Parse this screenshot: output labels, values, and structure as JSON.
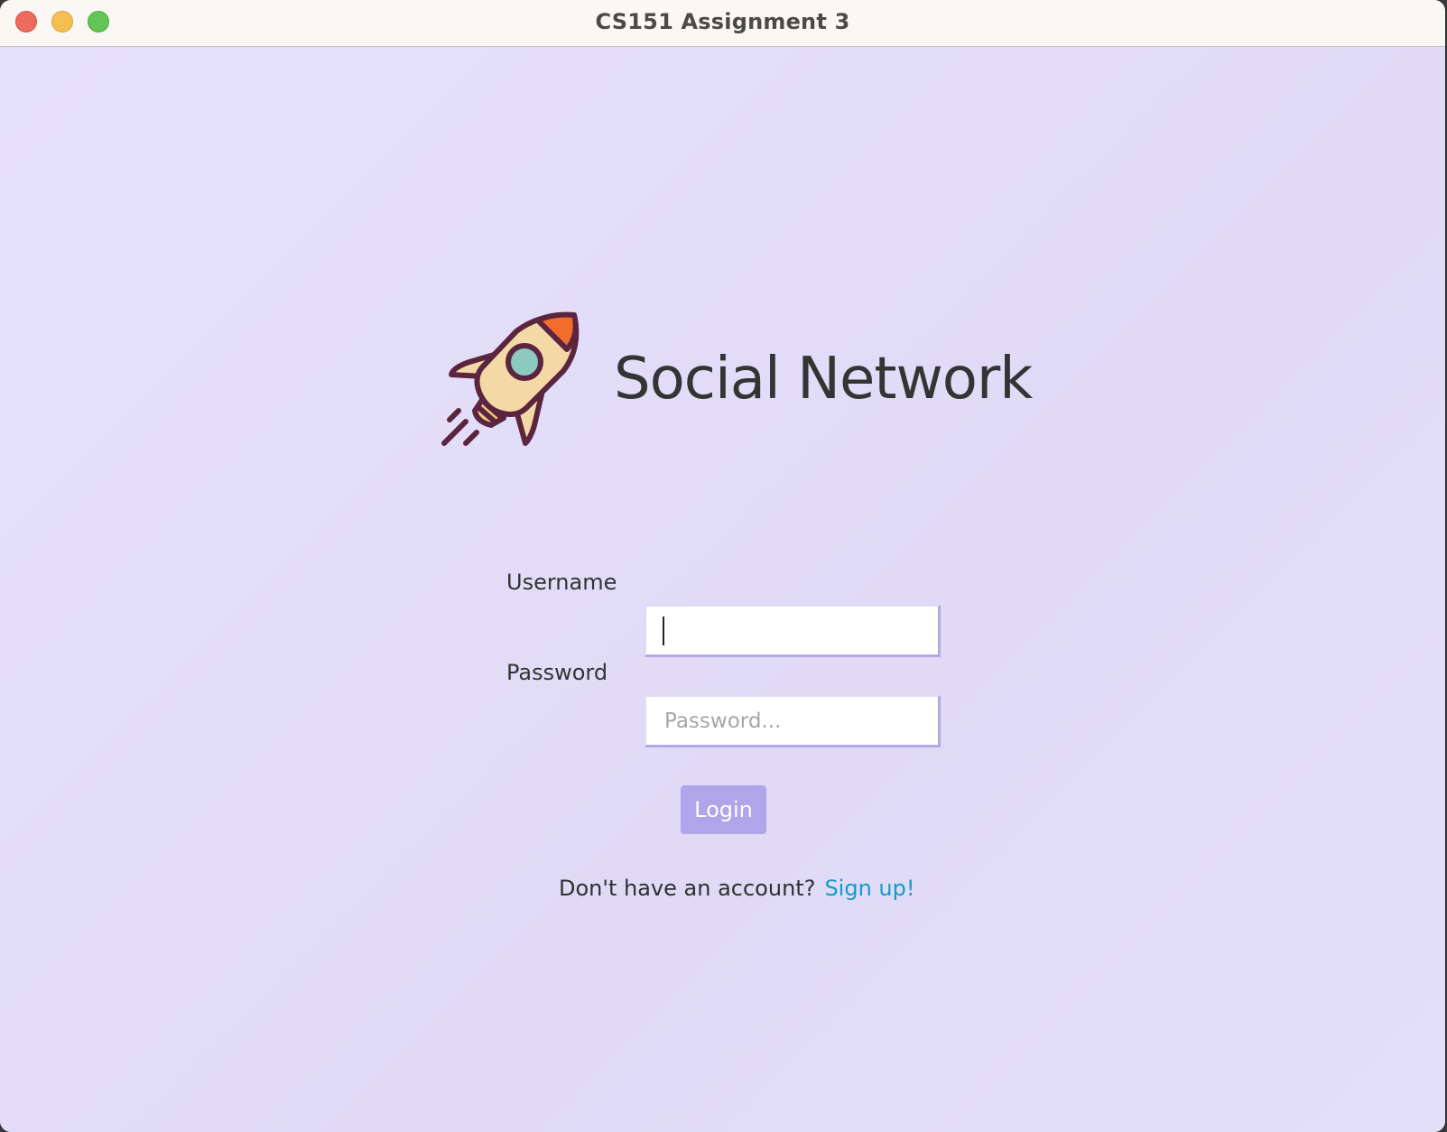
{
  "window": {
    "title": "CS151 Assignment 3"
  },
  "app": {
    "title": "Social Network",
    "logo_icon": "rocket-icon"
  },
  "login_form": {
    "username_label": "Username",
    "username_value": "",
    "username_placeholder": "",
    "password_label": "Password",
    "password_value": "",
    "password_placeholder": "Password...",
    "login_button_label": "Login"
  },
  "signup": {
    "prompt": "Don't have an account?",
    "link_label": "Sign up!"
  },
  "colors": {
    "background": "#e4dff8",
    "button": "#b0a4ea",
    "link": "#1899cc",
    "input_border_accent": "#b3a9e8"
  }
}
